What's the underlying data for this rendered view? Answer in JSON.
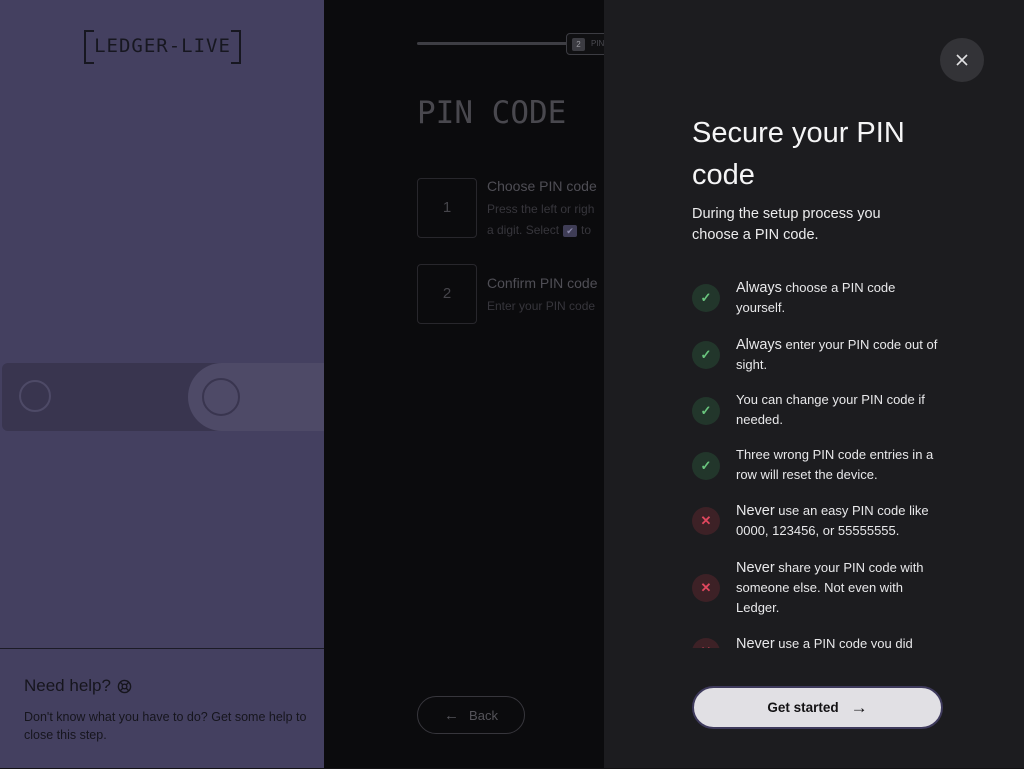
{
  "sidebar": {
    "logo_text": "LEDGER-LIVE",
    "help": {
      "title": "Need help?",
      "text": "Don't know what you have to do? Get some help to close this step."
    }
  },
  "main": {
    "progress": {
      "step_number": "2",
      "step_label": "PIN"
    },
    "title": "PIN CODE",
    "steps": [
      {
        "number": "1",
        "title": "Choose PIN code",
        "desc_a": "Press the left or righ",
        "desc_b": "a digit. Select",
        "desc_c": "to"
      },
      {
        "number": "2",
        "title": "Confirm PIN code",
        "desc": "Enter your PIN code"
      }
    ],
    "back_label": "Back"
  },
  "drawer": {
    "title": "Secure your PIN code",
    "intro": "During the setup process you choose a PIN code.",
    "tips": [
      {
        "type": "do",
        "lead": "Always",
        "rest": " choose a PIN code yourself."
      },
      {
        "type": "do",
        "lead": "Always",
        "rest": " enter your PIN code out of sight."
      },
      {
        "type": "do",
        "lead": "",
        "rest": "You can change your PIN code if needed."
      },
      {
        "type": "do",
        "lead": "",
        "rest": "Three wrong PIN code entries in a row will reset the device."
      },
      {
        "type": "dont",
        "lead": "Never",
        "rest": " use an easy PIN code like 0000, 123456, or 55555555."
      },
      {
        "type": "dont",
        "lead": "Never",
        "rest": " share your PIN code with someone else. Not even with Ledger."
      },
      {
        "type": "dont",
        "lead": "Never",
        "rest": " use a PIN code you did"
      }
    ],
    "cta_label": "Get started",
    "colors": {
      "ok": "#6ac57e",
      "no": "#e0475e",
      "accent": "#3e3a5c"
    }
  }
}
